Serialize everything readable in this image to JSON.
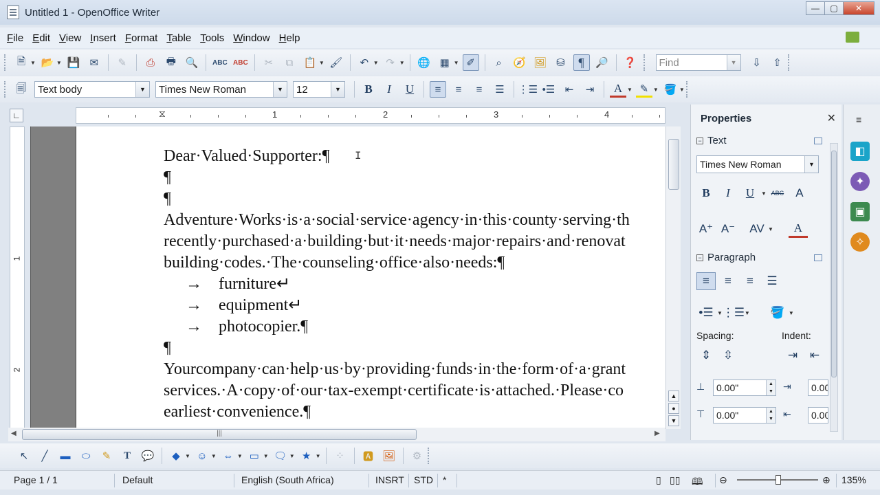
{
  "window": {
    "title": "Untitled 1 - OpenOffice Writer",
    "controls": [
      "minimize",
      "maximize",
      "close"
    ]
  },
  "menu": [
    "File",
    "Edit",
    "View",
    "Insert",
    "Format",
    "Table",
    "Tools",
    "Window",
    "Help"
  ],
  "toolbar": {
    "find_placeholder": "Find"
  },
  "formatting": {
    "paragraph_style": "Text body",
    "font_name": "Times New Roman",
    "font_size": "12"
  },
  "ruler": {
    "numbers": [
      "1",
      "2",
      "3",
      "4"
    ],
    "vertical_numbers": [
      "1",
      "2"
    ]
  },
  "document": {
    "lines": [
      "Dear·Valued·Supporter:¶",
      "¶",
      "¶",
      "Adventure·Works·is·a·social·service·agency·in·this·county·serving·th",
      "recently·purchased·a·building·but·it·needs·major·repairs·and·renovat",
      "building·codes.·The·counseling·office·also·needs:¶"
    ],
    "bullets": [
      {
        "arrow": "→",
        "text": "furniture↵"
      },
      {
        "arrow": "→",
        "text": "equipment↵"
      },
      {
        "arrow": "→",
        "text": "photocopier.¶"
      }
    ],
    "lines_after": [
      "¶",
      "Yourcompany·can·help·us·by·providing·funds·in·the·form·of·a·grant",
      "services.·A·copy·of·our·tax-exempt·certificate·is·attached.·Please·co",
      "earliest·convenience.¶"
    ]
  },
  "sidebar": {
    "title": "Properties",
    "text_section": "Text",
    "font_name": "Times New Roman",
    "paragraph_section": "Paragraph",
    "spacing_label": "Spacing:",
    "indent_label": "Indent:",
    "spacing_above": "0.00\"",
    "spacing_below": "0.00\"",
    "indent_before": "0.00\"",
    "indent_after": "0.00\""
  },
  "statusbar": {
    "page": "Page 1 / 1",
    "page_style": "Default",
    "language": "English (South Africa)",
    "insert_mode": "INSRT",
    "selection_mode": "STD",
    "modified": "*",
    "zoom": "135%",
    "zoom_level_percent": 135
  },
  "colors": {
    "accent": "#2c4a6e",
    "close_button": "#c8442a",
    "page_background": "#ffffff",
    "margin_gray": "#808080"
  }
}
